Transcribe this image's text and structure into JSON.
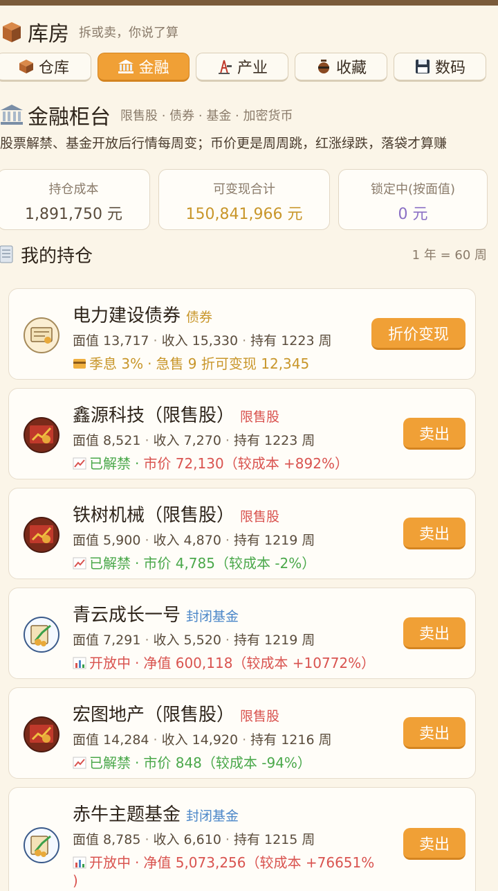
{
  "header": {
    "title": "库房",
    "subtitle": "拆或卖，你说了算",
    "icon": "box-icon"
  },
  "tabs": [
    {
      "label": "仓库",
      "icon": "box-icon",
      "active": false
    },
    {
      "label": "金融",
      "icon": "bank-icon",
      "active": true
    },
    {
      "label": "产业",
      "icon": "derrick-icon",
      "active": false
    },
    {
      "label": "收藏",
      "icon": "vase-icon",
      "active": false
    },
    {
      "label": "数码",
      "icon": "floppy-icon",
      "active": false
    }
  ],
  "section": {
    "title": "金融柜台",
    "tags": "限售股 · 债券 · 基金 · 加密货币",
    "description": "股票解禁、基金开放后行情每周变；币价更是周周跳，红涨绿跌，落袋才算赚"
  },
  "stats": [
    {
      "label": "持仓成本",
      "value": "1,891,750 元",
      "color": "#5a4c3c"
    },
    {
      "label": "可变现合计",
      "value": "150,841,966 元",
      "color": "#c8962a"
    },
    {
      "label": "锁定中(按面值)",
      "value": "0 元",
      "color": "#8a6fc4"
    }
  ],
  "holdings": {
    "title": "我的持仓",
    "note": "1 年 = 60 周",
    "items": [
      {
        "name": "电力建设债券",
        "tag": "债券",
        "tag_color": "#c8962a",
        "face": "面值 13,717",
        "income": "收入 15,330",
        "held": "持有 1223 周",
        "status_icon": "card-icon",
        "status": "季息 3%",
        "detail": "急售 9 折可变现 12,345",
        "status_color": "#c8962a",
        "button": "折价变现",
        "avatar": "bond-icon"
      },
      {
        "name": "鑫源科技（限售股）",
        "tag": "限售股",
        "tag_color": "#d9534f",
        "face": "面值 8,521",
        "income": "收入 7,270",
        "held": "持有 1223 周",
        "status_icon": "trend-up-icon",
        "status": "已解禁",
        "detail": "市价 72,130（较成本 +892%）",
        "status_color": "#4aa84a",
        "detail_color": "#d9534f",
        "button": "卖出",
        "avatar": "stock-icon"
      },
      {
        "name": "铁树机械（限售股）",
        "tag": "限售股",
        "tag_color": "#d9534f",
        "face": "面值 5,900",
        "income": "收入 4,870",
        "held": "持有 1219 周",
        "status_icon": "trend-up-icon",
        "status": "已解禁",
        "detail": "市价 4,785（较成本 -2%）",
        "status_color": "#4aa84a",
        "detail_color": "#4aa84a",
        "button": "卖出",
        "avatar": "stock-icon"
      },
      {
        "name": "青云成长一号",
        "tag": "封闭基金",
        "tag_color": "#4a86c8",
        "face": "面值 7,291",
        "income": "收入 5,520",
        "held": "持有 1219 周",
        "status_icon": "bar-chart-icon",
        "status": "开放中",
        "detail": "净值 600,118（较成本 +10772%）",
        "status_color": "#d9534f",
        "detail_color": "#d9534f",
        "button": "卖出",
        "avatar": "fund-icon"
      },
      {
        "name": "宏图地产（限售股）",
        "tag": "限售股",
        "tag_color": "#d9534f",
        "face": "面值 14,284",
        "income": "收入 14,920",
        "held": "持有 1216 周",
        "status_icon": "trend-up-icon",
        "status": "已解禁",
        "detail": "市价 848（较成本 -94%）",
        "status_color": "#4aa84a",
        "detail_color": "#4aa84a",
        "button": "卖出",
        "avatar": "stock-icon"
      },
      {
        "name": "赤牛主题基金",
        "tag": "封闭基金",
        "tag_color": "#4a86c8",
        "face": "面值 8,785",
        "income": "收入 6,610",
        "held": "持有 1215 周",
        "status_icon": "bar-chart-icon",
        "status": "开放中",
        "detail": "净值 5,073,256（较成本 +76651%",
        "detail_wrap": ")",
        "status_color": "#d9534f",
        "detail_color": "#d9534f",
        "button": "卖出",
        "avatar": "fund-icon"
      }
    ]
  },
  "separator": "·"
}
